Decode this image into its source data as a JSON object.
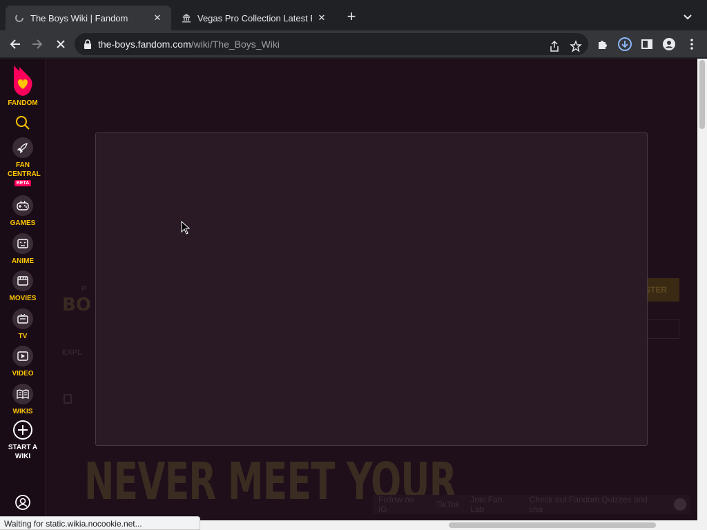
{
  "tabs": [
    {
      "title": "The Boys Wiki | Fandom",
      "active": true
    },
    {
      "title": "Vegas Pro Collection Latest Bu",
      "active": false
    }
  ],
  "address": {
    "host": "the-boys.fandom.com",
    "path": "/wiki/The_Boys_Wiki"
  },
  "sidebar": {
    "brand": "FANDOM",
    "items": [
      {
        "label": "FAN CENTRAL",
        "icon": "rocket-icon",
        "badge": "BETA"
      },
      {
        "label": "GAMES",
        "icon": "gamepad-icon"
      },
      {
        "label": "ANIME",
        "icon": "anime-icon"
      },
      {
        "label": "MOVIES",
        "icon": "movie-icon"
      },
      {
        "label": "TV",
        "icon": "tv-icon"
      },
      {
        "label": "VIDEO",
        "icon": "video-icon"
      },
      {
        "label": "WIKIS",
        "icon": "book-icon"
      },
      {
        "label": "START A WIKI",
        "icon": "plus-circle-icon"
      }
    ]
  },
  "background": {
    "hero_text": "NEVER MEET YOUR",
    "register_btn": "STER",
    "footer_links": [
      "Follow on IG",
      "TikTok",
      "Join Fan Lab",
      "Check out Fandom Quizzes and cha"
    ]
  },
  "status": "Waiting for static.wikia.nocookie.net...",
  "colors": {
    "accent": "#fa005a",
    "label": "#ffc500",
    "page_bg": "#1e0f1a"
  }
}
